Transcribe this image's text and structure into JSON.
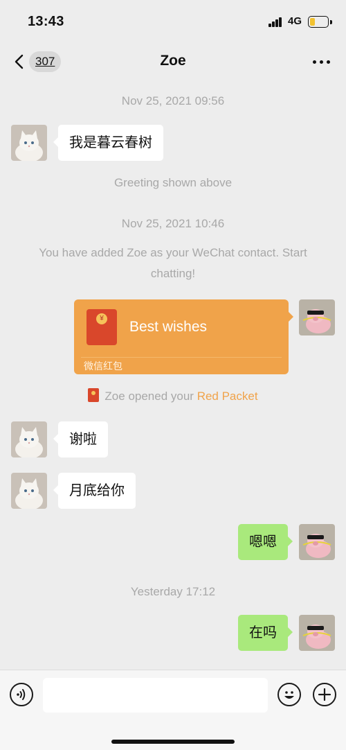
{
  "status_bar": {
    "time": "13:43",
    "network": "4G",
    "battery_level": 0.3
  },
  "nav": {
    "unread_count": "307",
    "title": "Zoe"
  },
  "messages": {
    "ts1": "Nov 25, 2021 09:56",
    "greeting": "我是暮云春树",
    "greeting_note": "Greeting shown above",
    "ts2": "Nov 25, 2021 10:46",
    "added_note": "You have added Zoe as your WeChat contact. Start chatting!",
    "red_packet": {
      "title": "Best wishes",
      "footer": "微信红包",
      "coin_symbol": "¥"
    },
    "packet_note": {
      "prefix": "Zoe opened your ",
      "highlight": "Red Packet"
    },
    "msg_thanks": "谢啦",
    "msg_month_end": "月底给你",
    "msg_enen": "嗯嗯",
    "ts3": "Yesterday 17:12",
    "msg_there": "在吗"
  },
  "colors": {
    "bubble_out": "#a9e97c",
    "red_packet": "#f0a34a",
    "background": "#ededed"
  },
  "icons": {
    "back": "chevron-left-icon",
    "more": "ellipsis-icon",
    "voice": "voice-icon",
    "emoji": "emoji-icon",
    "plus": "plus-icon"
  }
}
